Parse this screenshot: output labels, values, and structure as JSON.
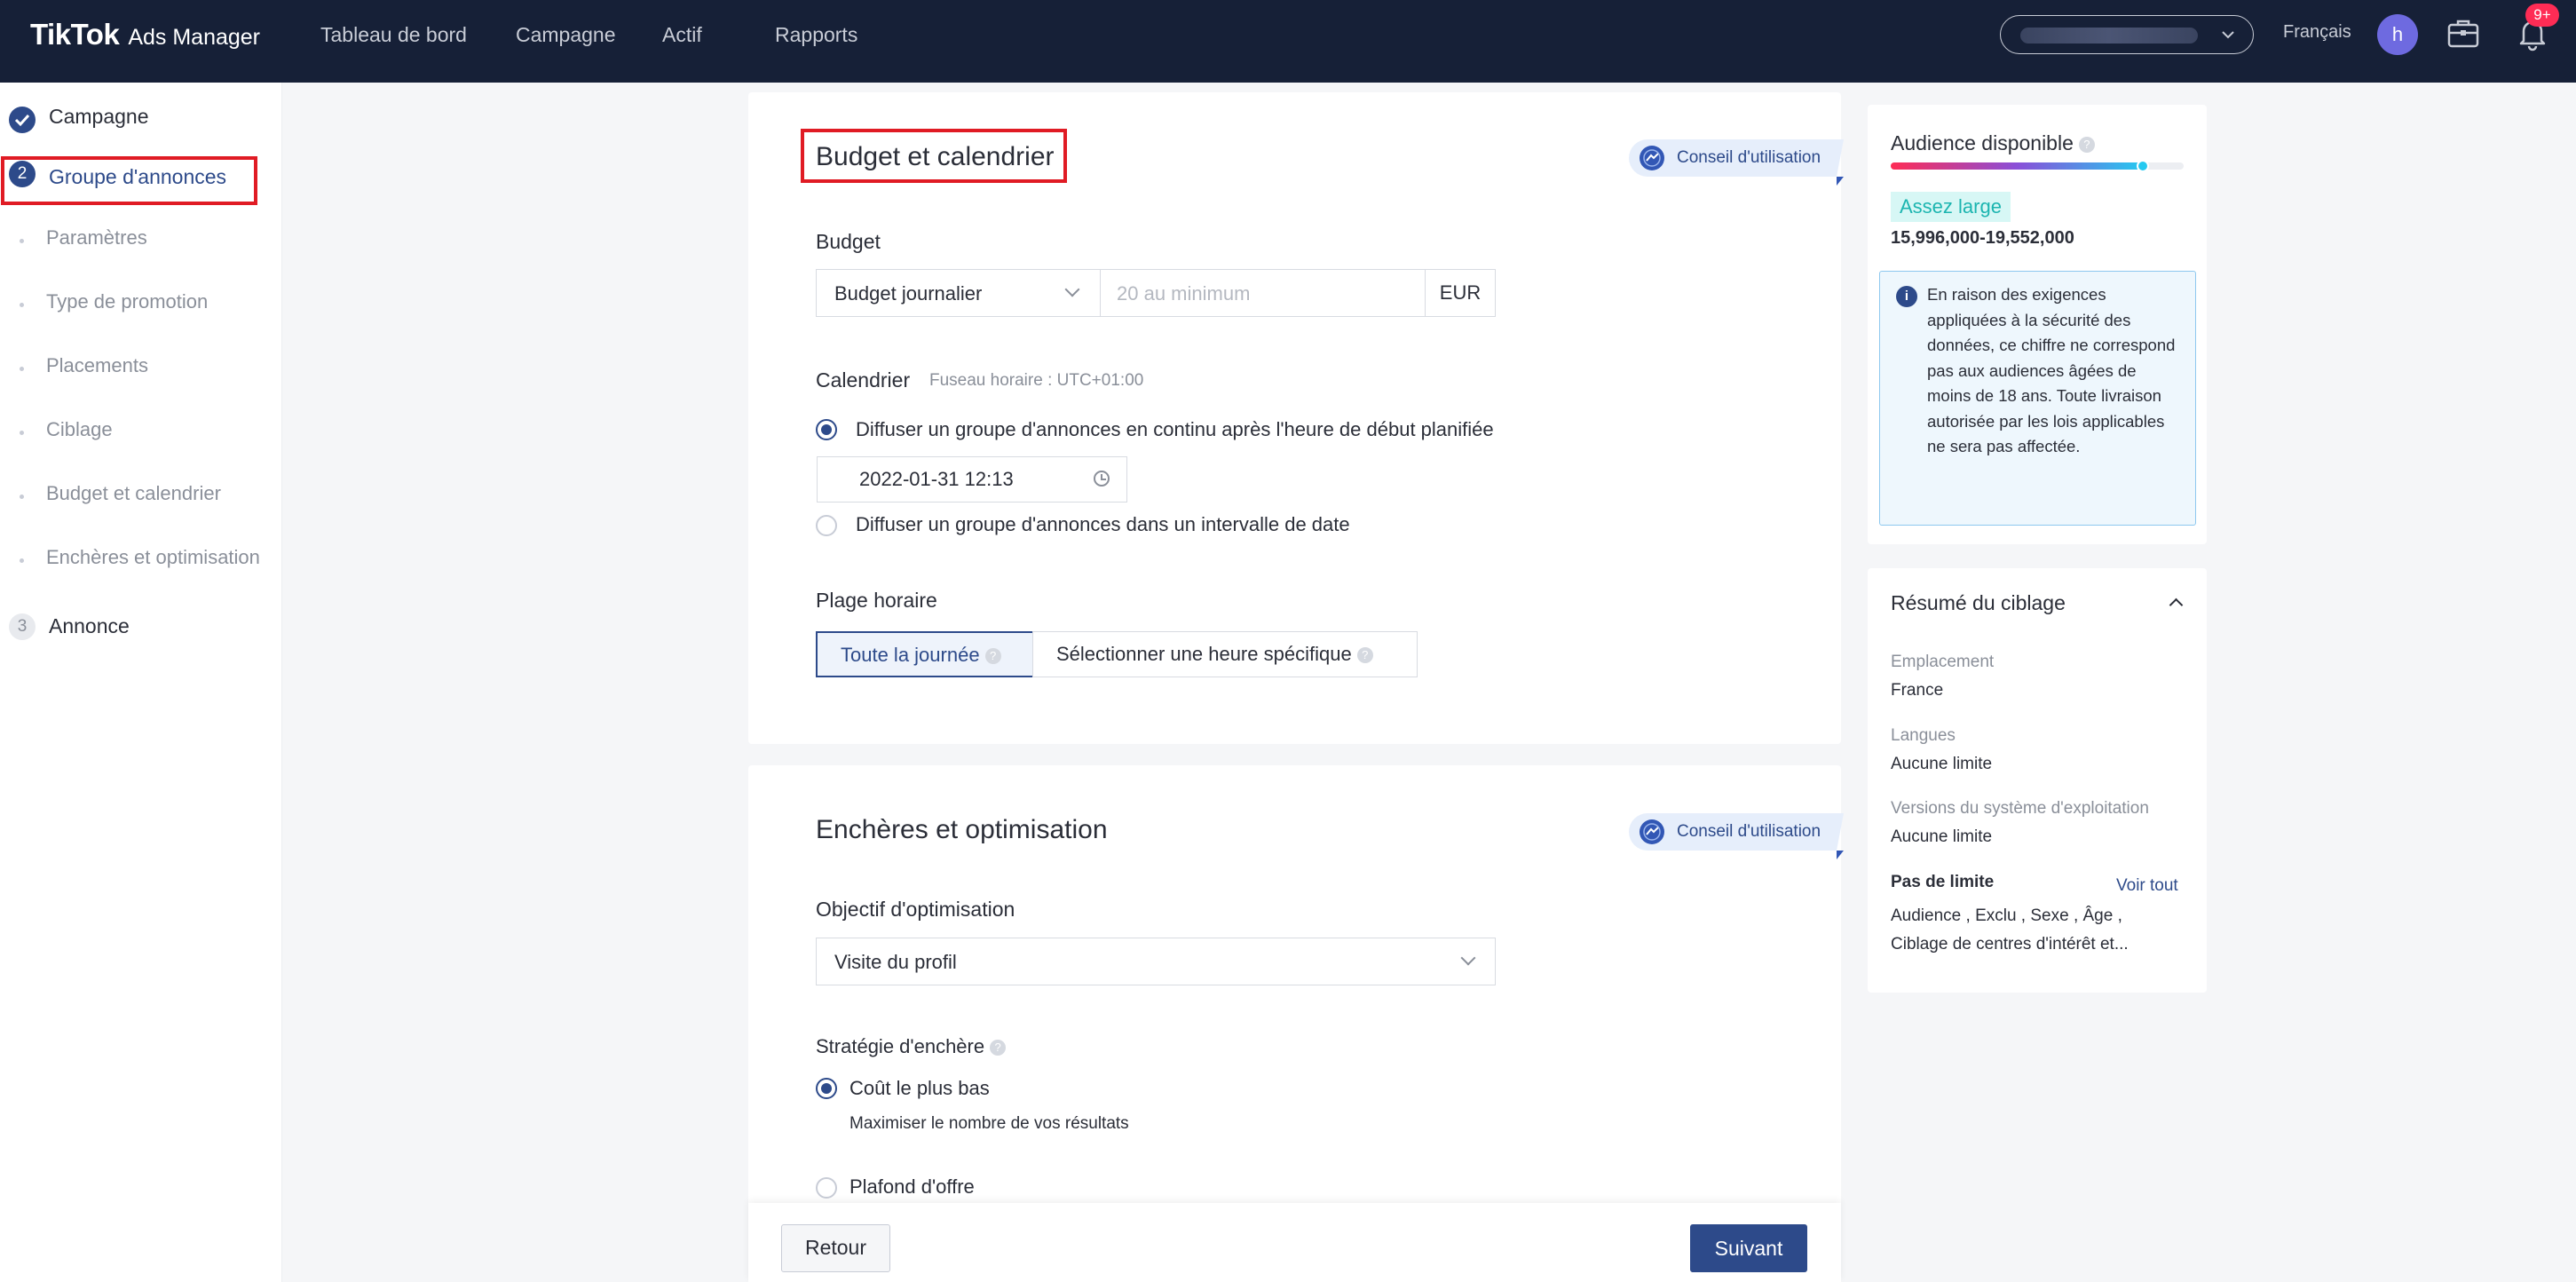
{
  "topbar": {
    "brand": "TikTok",
    "product": "Ads Manager",
    "nav": [
      "Tableau de bord",
      "Campagne",
      "Actif",
      "Rapports"
    ],
    "language": "Français",
    "avatar_letter": "h",
    "notification_count": "9+"
  },
  "sidebar": {
    "steps": [
      {
        "number": "",
        "label": "Campagne",
        "state": "done"
      },
      {
        "number": "2",
        "label": "Groupe d'annonces",
        "state": "active"
      },
      {
        "number": "3",
        "label": "Annonce",
        "state": "pending"
      }
    ],
    "sub_items": [
      "Paramètres",
      "Type de promotion",
      "Placements",
      "Ciblage",
      "Budget et calendrier",
      "Enchères et optimisation"
    ]
  },
  "budget_section": {
    "title": "Budget et calendrier",
    "tip_label": "Conseil d'utilisation",
    "budget_label": "Budget",
    "budget_type": "Budget journalier",
    "budget_placeholder": "20 au minimum",
    "currency": "EUR",
    "schedule_label": "Calendrier",
    "timezone": "Fuseau horaire : UTC+01:00",
    "option_continuous": "Diffuser un groupe d'annonces en continu après l'heure de début planifiée",
    "start_datetime": "2022-01-31 12:13",
    "option_range": "Diffuser un groupe d'annonces dans un intervalle de date",
    "dayparting_label": "Plage horaire",
    "dayparting_all": "Toute la journée",
    "dayparting_specific": "Sélectionner une heure spécifique"
  },
  "bidding_section": {
    "title": "Enchères et optimisation",
    "tip_label": "Conseil d'utilisation",
    "goal_label": "Objectif d'optimisation",
    "goal_value": "Visite du profil",
    "strategy_label": "Stratégie d'enchère",
    "lowest_cost": "Coût le plus bas",
    "lowest_cost_desc": "Maximiser le nombre de vos résultats",
    "bid_cap": "Plafond d'offre"
  },
  "footer": {
    "back": "Retour",
    "next": "Suivant"
  },
  "audience": {
    "title": "Audience disponible",
    "level_fraction": 0.86,
    "tag": "Assez large",
    "range": "15,996,000-19,552,000",
    "info": "En raison des exigences appliquées à la sécurité des données, ce chiffre ne correspond pas aux audiences âgées de moins de 18 ans. Toute livraison autorisée par les lois applicables ne sera pas affectée."
  },
  "targeting_summary": {
    "title": "Résumé du ciblage",
    "location_label": "Emplacement",
    "location_value": "France",
    "languages_label": "Langues",
    "languages_value": "Aucune limite",
    "os_label": "Versions du système d'exploitation",
    "os_value": "Aucune limite",
    "no_limit_label": "Pas de limite",
    "view_all": "Voir tout",
    "no_limit_line1": "Audience , Exclu , Sexe , Âge ,",
    "no_limit_line2": "Ciblage de centres d'intérêt et..."
  },
  "colors": {
    "nav_bg": "#162037",
    "primary": "#2d4a8a",
    "highlight_border": "#e01b24",
    "audience_tag": "#1cb5b0"
  },
  "icons": [
    "check-icon",
    "chevron-down-icon",
    "clock-icon",
    "help-icon",
    "info-icon",
    "chevron-up-icon",
    "briefcase-icon",
    "bell-icon",
    "tip-icon"
  ]
}
